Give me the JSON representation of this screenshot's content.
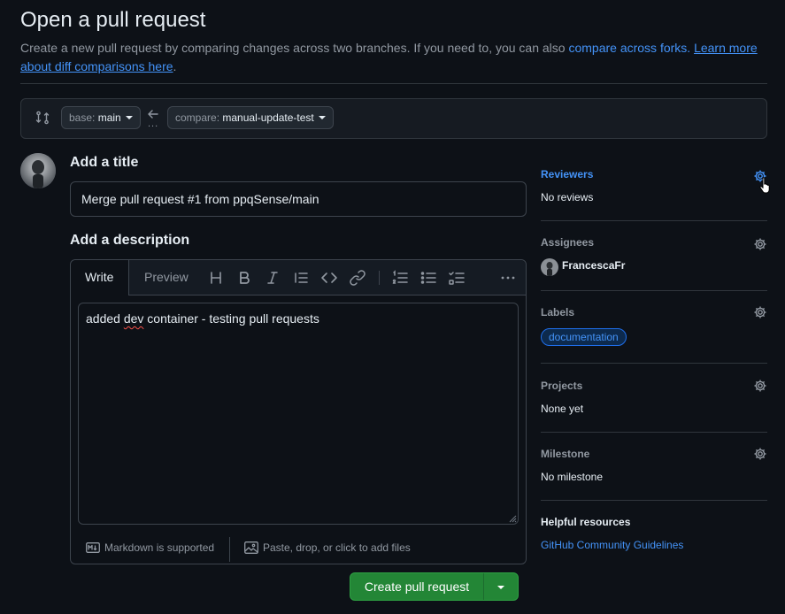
{
  "header": {
    "title": "Open a pull request",
    "subtitle_text": "Create a new pull request by comparing changes across two branches. If you need to, you can also ",
    "compare_forks_link": "compare across forks.",
    "learn_more_link": "Learn more about diff comparisons here",
    "subtitle_end": "."
  },
  "compare": {
    "base_label": "base:",
    "base_value": "main",
    "dots": "...",
    "compare_label": "compare:",
    "compare_value": "manual-update-test"
  },
  "form": {
    "title_heading": "Add a title",
    "title_value": "Merge pull request #1 from ppqSense/main",
    "description_heading": "Add a description",
    "tabs": {
      "write": "Write",
      "preview": "Preview"
    },
    "body_before": "added ",
    "body_misspelled": "dev",
    "body_after": " container - testing pull requests",
    "markdown_note": "Markdown is supported",
    "attach_note": "Paste, drop, or click to add files",
    "create_button": "Create pull request"
  },
  "sidebar": {
    "reviewers": {
      "heading": "Reviewers",
      "value": "No reviews"
    },
    "assignees": {
      "heading": "Assignees",
      "user": "FrancescaFr"
    },
    "labels": {
      "heading": "Labels",
      "badge": "documentation"
    },
    "projects": {
      "heading": "Projects",
      "value": "None yet"
    },
    "milestone": {
      "heading": "Milestone",
      "value": "No milestone"
    },
    "resources": {
      "heading": "Helpful resources",
      "link": "GitHub Community Guidelines"
    }
  },
  "colors": {
    "background": "#0d1117",
    "accent_link": "#4493f8",
    "primary_button": "#238636",
    "border": "#30363d"
  },
  "icons": [
    "git-compare-icon",
    "arrow-left-icon",
    "heading-icon",
    "bold-icon",
    "italic-icon",
    "quote-icon",
    "code-icon",
    "link-icon",
    "ordered-list-icon",
    "unordered-list-icon",
    "task-list-icon",
    "kebab-horizontal-icon",
    "markdown-icon",
    "image-icon",
    "gear-icon",
    "triangle-down-icon"
  ]
}
